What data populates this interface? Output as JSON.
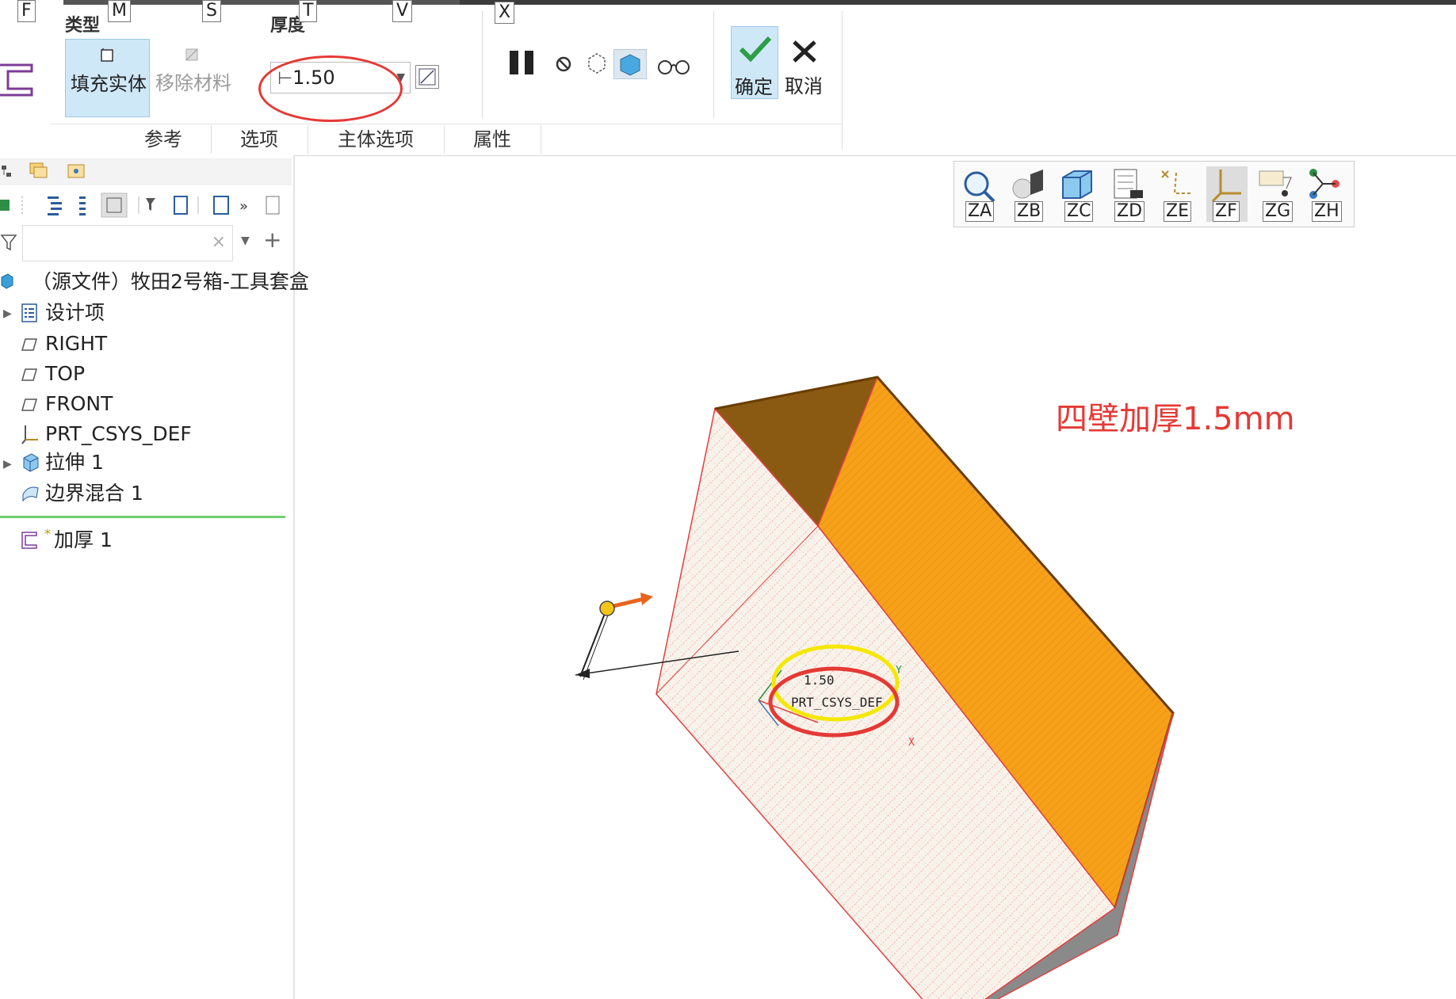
{
  "ribbon": {
    "keytips": {
      "f": "F",
      "m": "M",
      "s": "S",
      "t": "T",
      "v": "V",
      "x": "X"
    },
    "type_group": {
      "label": "类型",
      "fill_solid": "填充实体",
      "remove_material": "移除材料"
    },
    "thickness_group": {
      "label": "厚度",
      "value": "1.50"
    },
    "ok_label": "确定",
    "cancel_label": "取消",
    "tabs": [
      "参考",
      "选项",
      "主体选项",
      "属性"
    ]
  },
  "model_tree": {
    "root": "（源文件）牧田2号箱-工具套盒",
    "items": [
      "设计项",
      "RIGHT",
      "TOP",
      "FRONT",
      "PRT_CSYS_DEF",
      "拉伸 1",
      "边界混合 1"
    ],
    "insert_item": "加厚 1",
    "insert_mark": "*"
  },
  "view_toolbar": {
    "keytips": [
      "ZA",
      "ZB",
      "ZC",
      "ZD",
      "ZE",
      "ZF",
      "ZG",
      "ZH"
    ]
  },
  "viewport": {
    "dimension_label": "1.50",
    "csys_label": "PRT_CSYS_DEF",
    "axis_x": "X",
    "axis_y": "Y",
    "annotation": "四壁加厚1.5mm"
  },
  "colors": {
    "accent_blue": "#cfe8f7",
    "annotation_red": "#e53935",
    "face_orange": "#f39c12",
    "highlight_yellow": "#f5e800"
  }
}
